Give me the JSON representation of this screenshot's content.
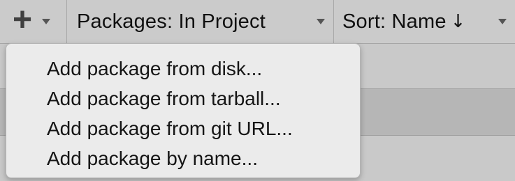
{
  "toolbar": {
    "add_icon": "plus-icon",
    "packages_label": "Packages: In Project",
    "sort_label": "Sort: Name",
    "sort_direction_icon": "arrow-down-icon",
    "sort_direction_glyph": "↓"
  },
  "menu": {
    "items": [
      {
        "label": "Add package from disk..."
      },
      {
        "label": "Add package from tarball..."
      },
      {
        "label": "Add package from git URL..."
      },
      {
        "label": "Add package by name..."
      }
    ]
  },
  "colors": {
    "toolbar_bg": "#cbcbcb",
    "menu_bg": "#ebebeb",
    "selected_row_bg": "#b6b6b6"
  }
}
